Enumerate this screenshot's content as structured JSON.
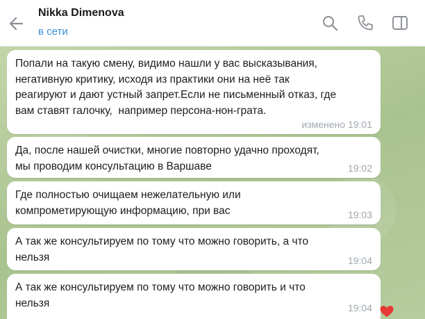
{
  "header": {
    "contact_name": "Nikka Dimenova",
    "status": "в сети",
    "icons": [
      "back-arrow-icon",
      "search-icon",
      "phone-icon",
      "sidebar-toggle-icon"
    ]
  },
  "messages": [
    {
      "text": "Попали на такую смену, видимо нашли у вас высказывания,\nнегативную критику, исходя из практики они на неё так\nреагируют и дают устный запрет.Если не письменный отказ, где\nвам ставят галочку,  например персона-нон-грата.",
      "time": "изменено 19:01"
    },
    {
      "text": "Да, после нашей очистки, многие повторно удачно проходят,\nмы проводим консультацию в Варшаве",
      "time": "19:02"
    },
    {
      "text": "Где полностью очищаем нежелательную или\nкомпрометирующую информацию, при вас",
      "time": "19:03"
    },
    {
      "text": "А так же консультируем по тому что можно говорить, а что\nнельзя",
      "time": "19:04"
    },
    {
      "text": "А так же консультируем по тому что можно говорить и что\nнельзя",
      "time": "19:04",
      "reaction": "heart-icon"
    }
  ],
  "colors": {
    "status_blue": "#3a8fd6",
    "bubble_bg": "#ffffff",
    "time_gray": "#a0a7ad",
    "reaction_red": "#e53935"
  }
}
